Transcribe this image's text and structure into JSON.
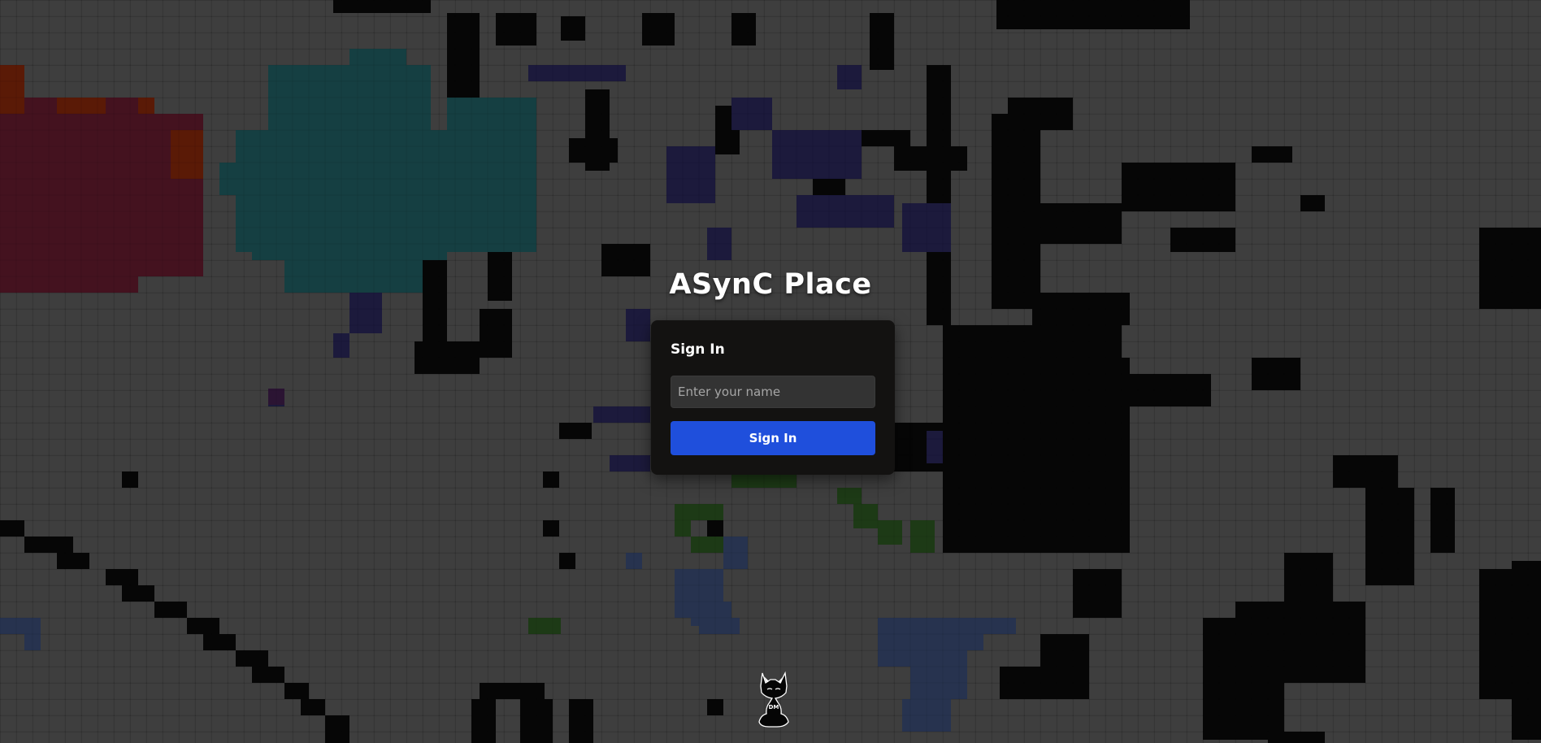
{
  "app": {
    "title": "ASynC Place"
  },
  "login": {
    "heading": "Sign In",
    "name_placeholder": "Enter your name",
    "name_value": "",
    "submit_label": "Sign In"
  },
  "mascot": {
    "icon": "cat-mascot-icon",
    "badge_text": "DM"
  },
  "colors": {
    "background": "#3e3e3e",
    "pixel_black": "#060606",
    "pixel_teal": "#153f42",
    "pixel_maroon": "#44121f",
    "pixel_navy": "#1c1a3c",
    "pixel_slate_blue": "#27334f",
    "pixel_green": "#1d3a16",
    "pixel_brown": "#5a1a06",
    "card": "#131211",
    "accent_blue": "#1f4fdc"
  }
}
